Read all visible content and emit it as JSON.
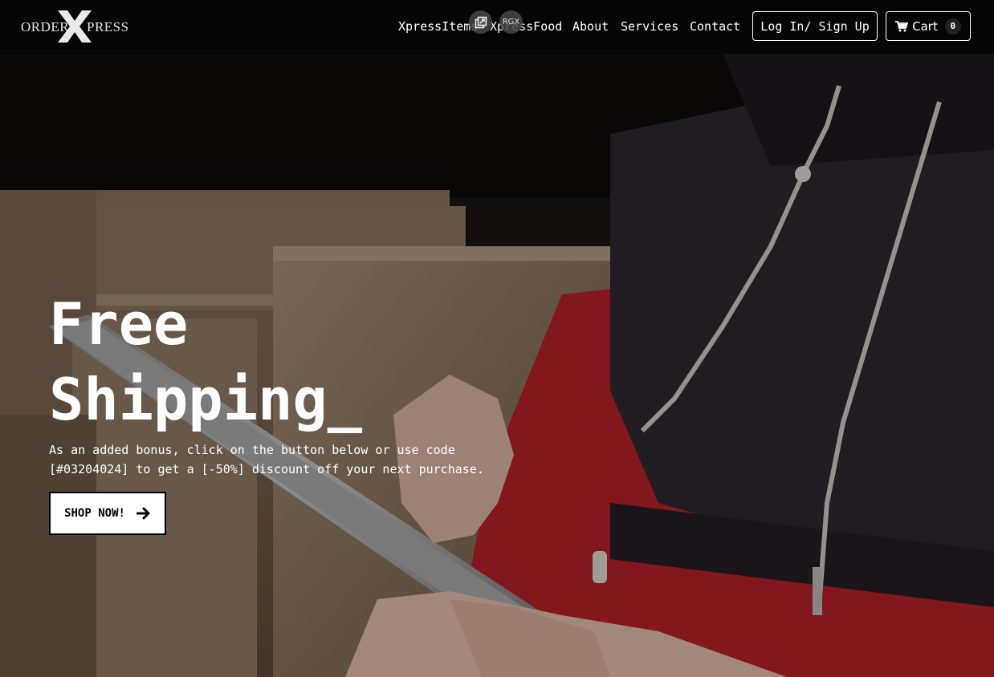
{
  "logo": {
    "left_word": "ORDER",
    "big_letter": "X",
    "right_word": "PRESS"
  },
  "nav": {
    "links": [
      {
        "label": "XpressItems"
      },
      {
        "label": "XpressFood"
      },
      {
        "label": "About"
      },
      {
        "label": "Services"
      },
      {
        "label": "Contact"
      }
    ],
    "login_label": "Log In/ Sign Up",
    "cart_label": "Cart",
    "cart_count": "0",
    "badge_external_icon": "external-link-icon",
    "badge_rgx_label": "RGX"
  },
  "hero": {
    "title_line1": "Free",
    "title_line2": "Shipping_",
    "text_line1": "As an added bonus, click on the button below or use code",
    "text_line2": "[#03204024] to get a [-50%] discount off your next purchase.",
    "button_label": "SHOP NOW!",
    "button_icon": "arrow-right-icon"
  },
  "colors": {
    "navbar_bg": "#050505",
    "text": "#ffffff",
    "jacket_red": "#c8232b",
    "jacket_dark": "#2e2630"
  }
}
